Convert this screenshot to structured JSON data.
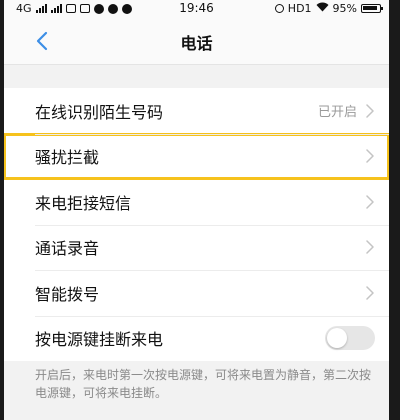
{
  "status_bar": {
    "network": "4G",
    "time": "19:46",
    "hd": "HD1",
    "battery": "95%"
  },
  "nav": {
    "title": "电话"
  },
  "settings": {
    "items": [
      {
        "label": "在线识别陌生号码",
        "value": "已开启",
        "control": "chevron"
      },
      {
        "label": "骚扰拦截",
        "value": "",
        "control": "chevron"
      },
      {
        "label": "来电拒接短信",
        "value": "",
        "control": "chevron"
      },
      {
        "label": "通话录音",
        "value": "",
        "control": "chevron"
      },
      {
        "label": "智能拨号",
        "value": "",
        "control": "chevron"
      },
      {
        "label": "按电源键挂断来电",
        "value": "",
        "control": "toggle",
        "toggle_on": false
      }
    ],
    "footnote": "开启后，来电时第一次按电源键，可将来电置为静音，第二次按电源键，可将来电挂断。"
  },
  "colors": {
    "highlight": "#f6c21c",
    "accent": "#3c8ee6"
  }
}
